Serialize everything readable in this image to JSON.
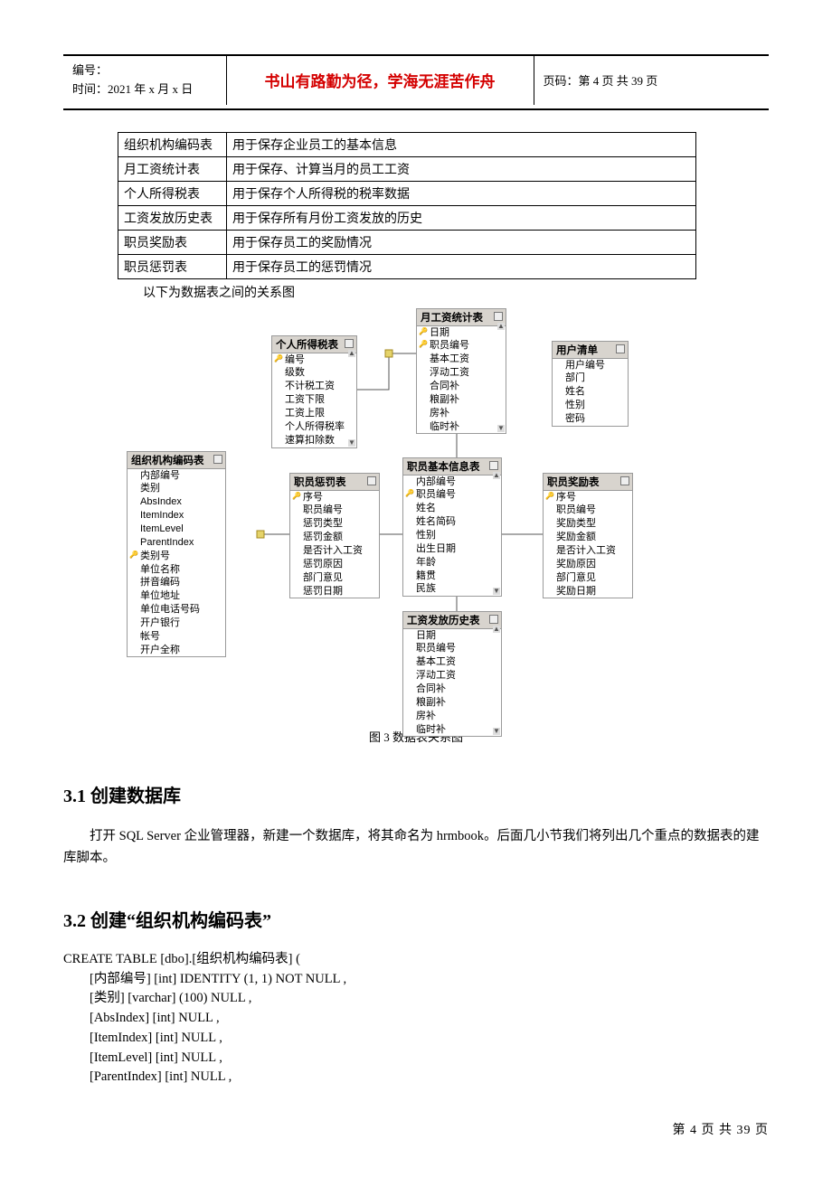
{
  "header": {
    "id_label": "编号：",
    "date_label": "时间：2021 年 x 月 x 日",
    "center": "书山有路勤为径，学海无涯苦作舟",
    "right": "页码：第 4 页 共 39 页"
  },
  "table_rows": [
    [
      "组织机构编码表",
      "用于保存企业员工的基本信息"
    ],
    [
      "月工资统计表",
      "用于保存、计算当月的员工工资"
    ],
    [
      "个人所得税表",
      "用于保存个人所得税的税率数据"
    ],
    [
      "工资发放历史表",
      "用于保存所有月份工资发放的历史"
    ],
    [
      "职员奖励表",
      "用于保存员工的奖励情况"
    ],
    [
      "职员惩罚表",
      "用于保存员工的惩罚情况"
    ]
  ],
  "subcaption": "以下为数据表之间的关系图",
  "diagram": {
    "caption": "图 3  数据表关系图",
    "entities": {
      "salary": {
        "title": "月工资统计表",
        "keys": [
          "日期",
          "职员编号"
        ],
        "fields": [
          "基本工资",
          "浮动工资",
          "合同补",
          "粮副补",
          "房补",
          "临时补"
        ]
      },
      "tax": {
        "title": "个人所得税表",
        "keys": [
          "编号"
        ],
        "fields": [
          "级数",
          "不计税工资",
          "工资下限",
          "工资上限",
          "个人所得税率",
          "速算扣除数"
        ]
      },
      "user": {
        "title": "用户清单",
        "keys": [],
        "fields": [
          "用户编号",
          "部门",
          "姓名",
          "性别",
          "密码"
        ]
      },
      "org": {
        "title": "组织机构编码表",
        "keys": [
          "类别号"
        ],
        "fields": [
          "内部编号",
          "类别",
          "AbsIndex",
          "ItemIndex",
          "ItemLevel",
          "ParentIndex",
          "单位名称",
          "拼音编码",
          "单位地址",
          "单位电话号码",
          "开户银行",
          "帐号",
          "开户全称"
        ]
      },
      "punish": {
        "title": "职员惩罚表",
        "keys": [
          "序号"
        ],
        "fields": [
          "职员编号",
          "惩罚类型",
          "惩罚金额",
          "是否计入工资",
          "惩罚原因",
          "部门意见",
          "惩罚日期"
        ]
      },
      "emp": {
        "title": "职员基本信息表",
        "keys": [
          "职员编号"
        ],
        "fields": [
          "内部编号",
          "姓名",
          "姓名简码",
          "性别",
          "出生日期",
          "年龄",
          "籍贯",
          "民族"
        ]
      },
      "reward": {
        "title": "职员奖励表",
        "keys": [
          "序号"
        ],
        "fields": [
          "职员编号",
          "奖励类型",
          "奖励金额",
          "是否计入工资",
          "奖励原因",
          "部门意见",
          "奖励日期"
        ]
      },
      "history": {
        "title": "工资发放历史表",
        "keys": [],
        "fields": [
          "日期",
          "职员编号",
          "基本工资",
          "浮动工资",
          "合同补",
          "粮副补",
          "房补",
          "临时补"
        ]
      }
    }
  },
  "sec31": {
    "title": "3.1 创建数据库",
    "para": "打开 SQL Server 企业管理器，新建一个数据库，将其命名为 hrmbook。后面几小节我们将列出几个重点的数据表的建库脚本。"
  },
  "sec32": {
    "title": "3.2 创建“组织机构编码表”",
    "code": "CREATE TABLE [dbo].[组织机构编码表] (\n        [内部编号] [int] IDENTITY (1, 1) NOT NULL ,\n        [类别] [varchar] (100) NULL ,\n        [AbsIndex] [int] NULL ,\n        [ItemIndex] [int] NULL ,\n        [ItemLevel] [int] NULL ,\n        [ParentIndex] [int] NULL ,"
  },
  "footer": "第 4 页 共 39 页"
}
